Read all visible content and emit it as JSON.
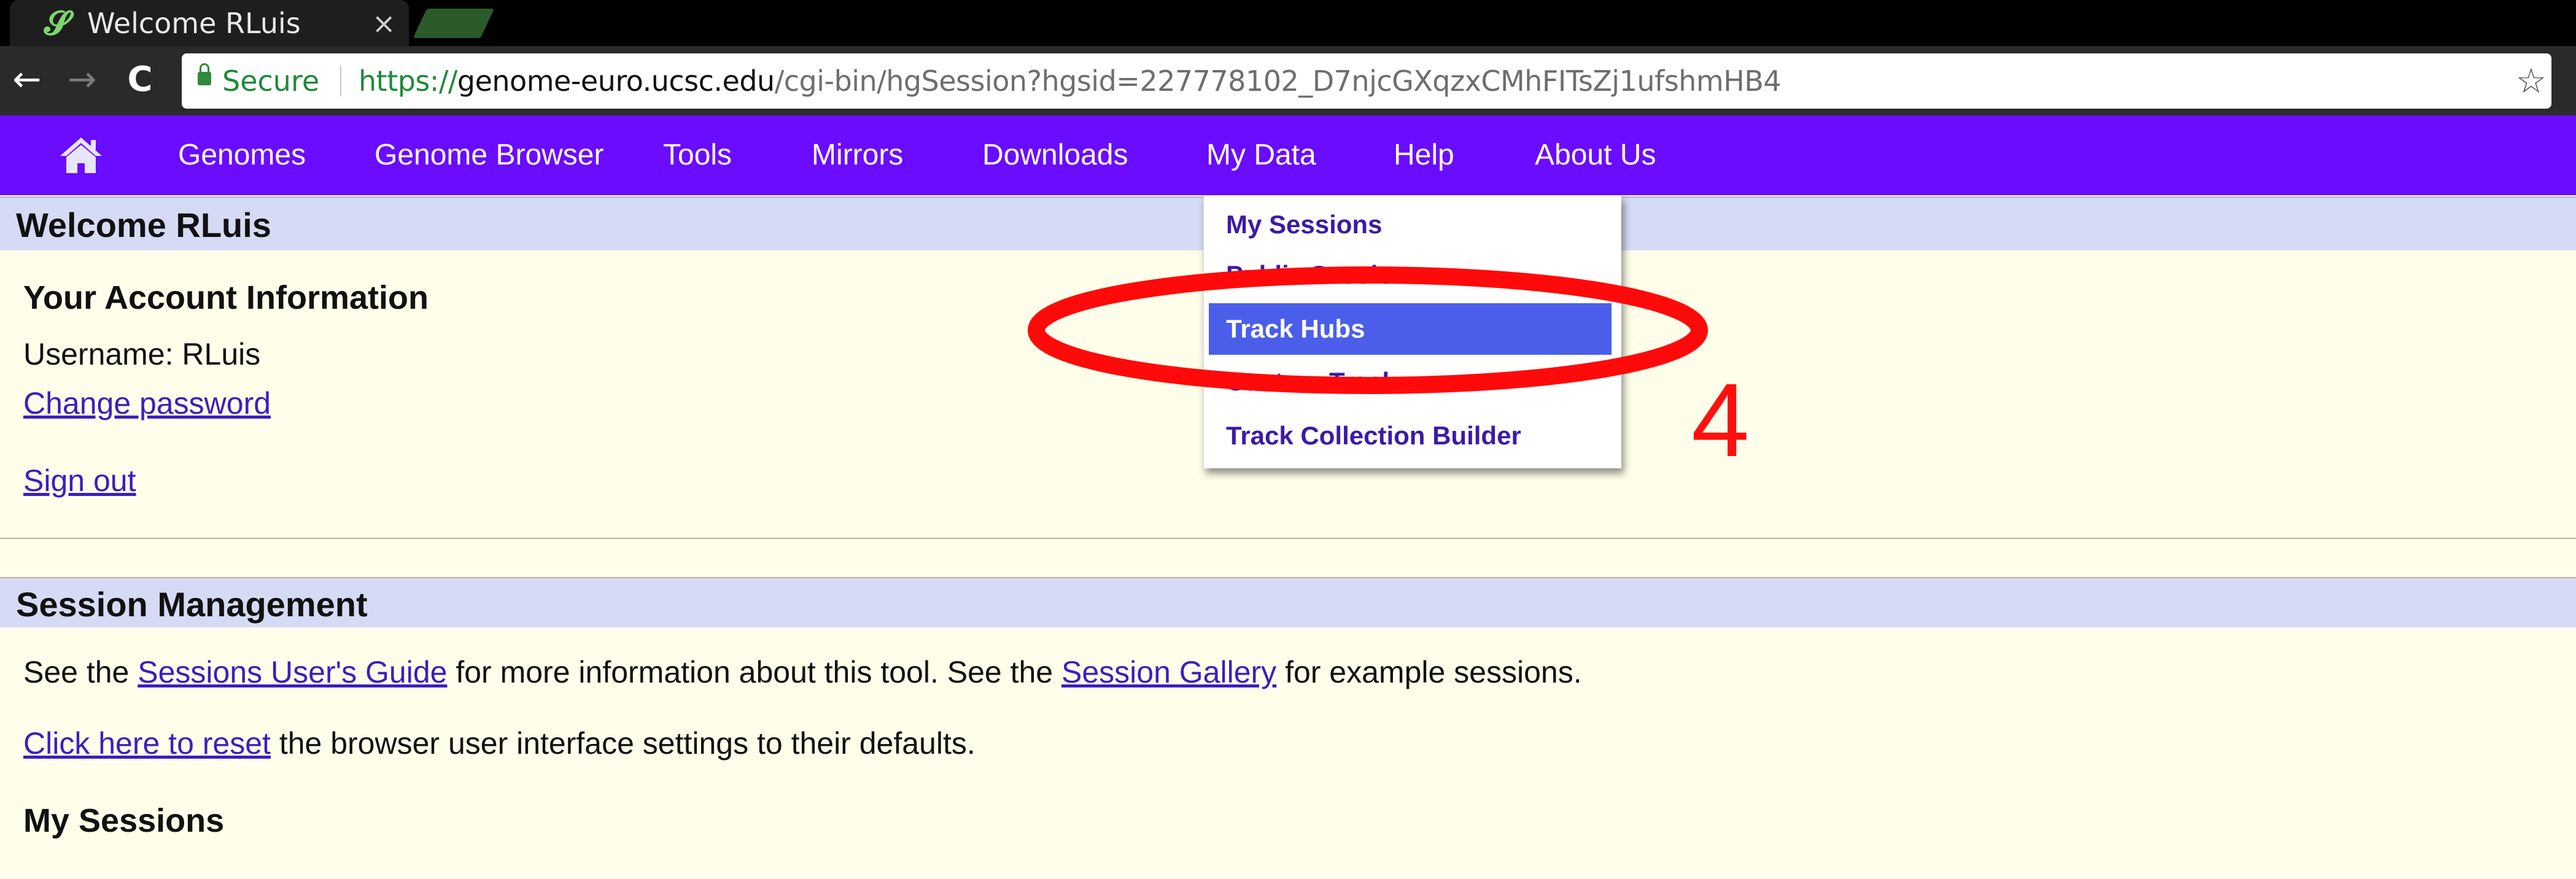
{
  "browser": {
    "tab_title": "Welcome RLuis",
    "tab_favicon": "ucsc-favicon",
    "close_icon": "×",
    "back": "←",
    "forward": "→",
    "reload": "C",
    "secure_label": "Secure",
    "url_scheme": "https://",
    "url_host": "genome-euro.ucsc.edu",
    "url_path": "/cgi-bin/hgSession?hgsid=227778102_D7njcGXqzxCMhFITsZj1ufshmHB4",
    "star": "☆"
  },
  "navbar": {
    "color": "#6a0cff",
    "items": [
      "Genomes",
      "Genome Browser",
      "Tools",
      "Mirrors",
      "Downloads",
      "My Data",
      "Help",
      "About Us"
    ]
  },
  "welcome": {
    "title": "Welcome RLuis",
    "account_heading": "Your Account Information",
    "username_line": "Username: RLuis",
    "change_password": "Change password",
    "sign_out": "Sign out"
  },
  "session_mgmt": {
    "title": "Session Management",
    "line1_pre": "See the ",
    "line1_link1": "Sessions User's Guide",
    "line1_mid": " for more information about this tool. See the ",
    "line1_link2": "Session Gallery",
    "line1_post": " for example sessions.",
    "line2_link": "Click here to reset",
    "line2_post": " the browser user interface settings to their defaults.",
    "my_sessions_heading": "My Sessions"
  },
  "dropdown": {
    "items": [
      {
        "label": "My Sessions",
        "active": false
      },
      {
        "label": "Public Sessions",
        "active": false
      },
      {
        "label": "Track Hubs",
        "active": true
      },
      {
        "label": "Custom Tracks",
        "active": false
      },
      {
        "label": "Track Collection Builder",
        "active": false
      }
    ]
  },
  "annotation": {
    "number": "4",
    "color": "#ff1010"
  }
}
